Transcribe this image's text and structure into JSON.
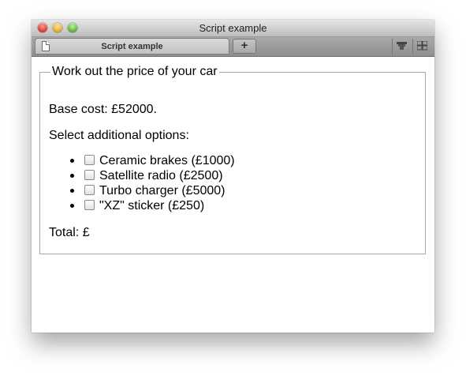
{
  "window": {
    "title": "Script example"
  },
  "tabbar": {
    "active_tab_label": "Script example",
    "new_tab_label": "+"
  },
  "form": {
    "legend": "Work out the price of your car",
    "base_cost": "Base cost: £52000.",
    "select_prompt": "Select additional options:",
    "options": [
      {
        "label": "Ceramic brakes (£1000)",
        "checked": false
      },
      {
        "label": "Satellite radio (£2500)",
        "checked": false
      },
      {
        "label": "Turbo charger (£5000)",
        "checked": false
      },
      {
        "label": "\"XZ\" sticker (£250)",
        "checked": false
      }
    ],
    "total": "Total: £"
  },
  "icons": {
    "tab_icon": "document-icon",
    "bookmarks": "bookmarks-icon",
    "tab_overview": "grid-icon"
  }
}
